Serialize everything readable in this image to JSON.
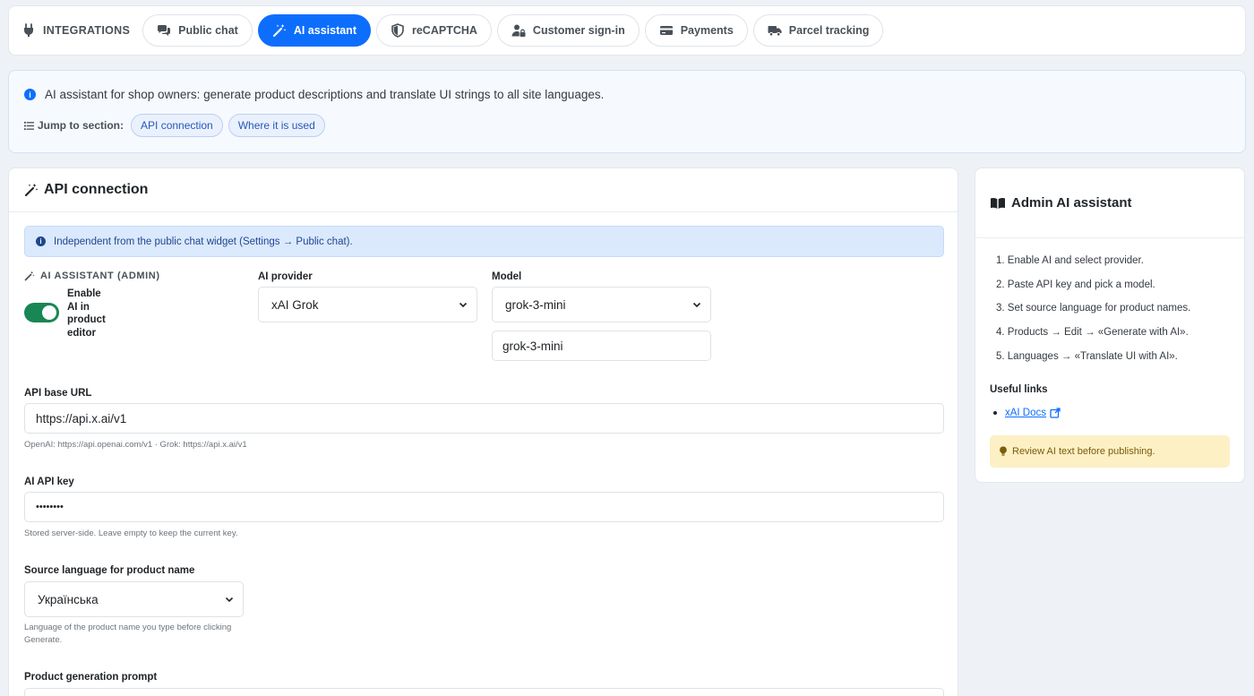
{
  "nav": {
    "title": "INTEGRATIONS",
    "tabs": [
      {
        "label": "Public chat",
        "icon": "comments-icon"
      },
      {
        "label": "AI assistant",
        "icon": "magic-wand-icon"
      },
      {
        "label": "reCAPTCHA",
        "icon": "shield-icon"
      },
      {
        "label": "Customer sign-in",
        "icon": "user-lock-icon"
      },
      {
        "label": "Payments",
        "icon": "credit-card-icon"
      },
      {
        "label": "Parcel tracking",
        "icon": "truck-icon"
      }
    ],
    "active_tab": "AI assistant"
  },
  "info": {
    "text": "AI assistant for shop owners: generate product descriptions and translate UI strings to all site languages.",
    "jump_label": "Jump to section:",
    "jump_links": [
      "API connection",
      "Where it is used"
    ]
  },
  "main": {
    "title": "API connection",
    "alert": "Independent from the public chat widget (Settings → Public chat).",
    "section_tag": "AI ASSISTANT (ADMIN)",
    "toggle_label": "Enable AI in product editor",
    "toggle_on": true,
    "provider_label": "AI provider",
    "provider_value": "xAI Grok",
    "model_label": "Model",
    "model_select_value": "grok-3-mini",
    "model_input_value": "grok-3-mini",
    "base_url_label": "API base URL",
    "base_url_value": "https://api.x.ai/v1",
    "base_url_help": "OpenAI: https://api.openai.com/v1 · Grok: https://api.x.ai/v1",
    "api_key_label": "AI API key",
    "api_key_value": "••••••••",
    "api_key_help": "Stored server-side. Leave empty to keep the current key.",
    "source_lang_label": "Source language for product name",
    "source_lang_value": "Українська",
    "source_lang_help": "Language of the product name you type before clicking Generate.",
    "prompt_label": "Product generation prompt"
  },
  "side": {
    "title": "Admin AI assistant",
    "steps": [
      "1. Enable AI and select provider.",
      "2. Paste API key and pick a model.",
      "3. Set source language for product names.",
      "4. Products → Edit → «Generate with AI».",
      "5. Languages → «Translate UI with AI»."
    ],
    "useful_links_label": "Useful links",
    "link_text": "xAI Docs",
    "warning": "Review AI text before publishing."
  },
  "colors": {
    "accent": "#0d6efd",
    "toggle_on": "#198754",
    "warning_bg": "#fcf0c4",
    "info_bg": "#dbe9fd"
  }
}
